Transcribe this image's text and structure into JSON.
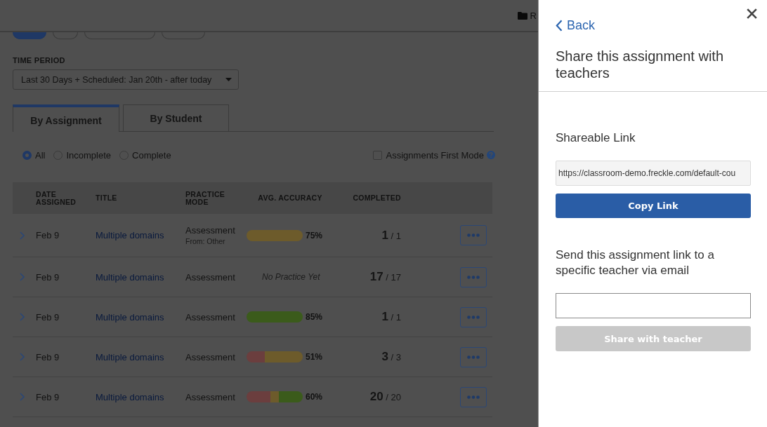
{
  "header": {
    "folder_link": "R"
  },
  "filter_pills": [
    {
      "selected": true
    },
    {
      "selected": false
    },
    {
      "selected": false
    },
    {
      "selected": false
    }
  ],
  "time_period": {
    "label": "TIME PERIOD",
    "value": "Last 30 Days + Scheduled: Jan 20th - after today"
  },
  "tabs": [
    {
      "label": "By Assignment",
      "selected": true
    },
    {
      "label": "By Student",
      "selected": false
    }
  ],
  "status_filter": [
    {
      "label": "All",
      "selected": true
    },
    {
      "label": "Incomplete",
      "selected": false
    },
    {
      "label": "Complete",
      "selected": false
    }
  ],
  "assignments_first_mode": {
    "label": "Assignments First Mode",
    "checked": false
  },
  "table": {
    "columns": [
      "DATE ASSIGNED",
      "TITLE",
      "PRACTICE MODE",
      "AVG. ACCURACY",
      "COMPLETED"
    ],
    "rows": [
      {
        "date": "Feb 9",
        "title": "Multiple domains",
        "mode": "Assessment",
        "source": "From: Other",
        "accuracy": {
          "segments": [
            {
              "color": "#6d5b2b",
              "level": 1
            }
          ],
          "percent": "75%"
        },
        "completed": "**1** / 1"
      },
      {
        "date": "Feb 9",
        "title": "Multiple domains",
        "mode": "Assessment",
        "accuracy": {
          "note": "No Practice Yet"
        },
        "completed": "**17** / 17"
      },
      {
        "date": "Feb 9",
        "title": "Multiple domains",
        "mode": "Assessment",
        "accuracy": {
          "segments": [
            {
              "color": "#3b5b1b",
              "level": 1
            }
          ],
          "percent": "85%"
        },
        "completed": "**1** / 1"
      },
      {
        "date": "Feb 9",
        "title": "Multiple domains",
        "mode": "Assessment",
        "accuracy": {
          "segments": [
            {
              "color": "#6b3e3e",
              "level": 0.33
            },
            {
              "color": "#6d5b2b",
              "level": 0.67
            }
          ],
          "percent": "51%"
        },
        "completed": "**3** / 3"
      },
      {
        "date": "Feb 9",
        "title": "Multiple domains",
        "mode": "Assessment",
        "accuracy": {
          "segments": [
            {
              "color": "#6b3e3e",
              "level": 0.42
            },
            {
              "color": "#6d5b2b",
              "level": 0.15
            },
            {
              "color": "#3b5b1b",
              "level": 0.43
            }
          ],
          "percent": "60%"
        },
        "completed": "**20** / 20"
      }
    ]
  },
  "share_panel": {
    "back": "Back",
    "title": "Share this assignment with teachers",
    "link_label": "Shareable Link",
    "link_value": "https://classroom-demo.freckle.com/default-cou",
    "copy_button": "Copy Link",
    "email_label": "Send this assignment link to a specific teacher via email",
    "share_button": {
      "label": "Share with teacher",
      "disabled": true
    }
  }
}
